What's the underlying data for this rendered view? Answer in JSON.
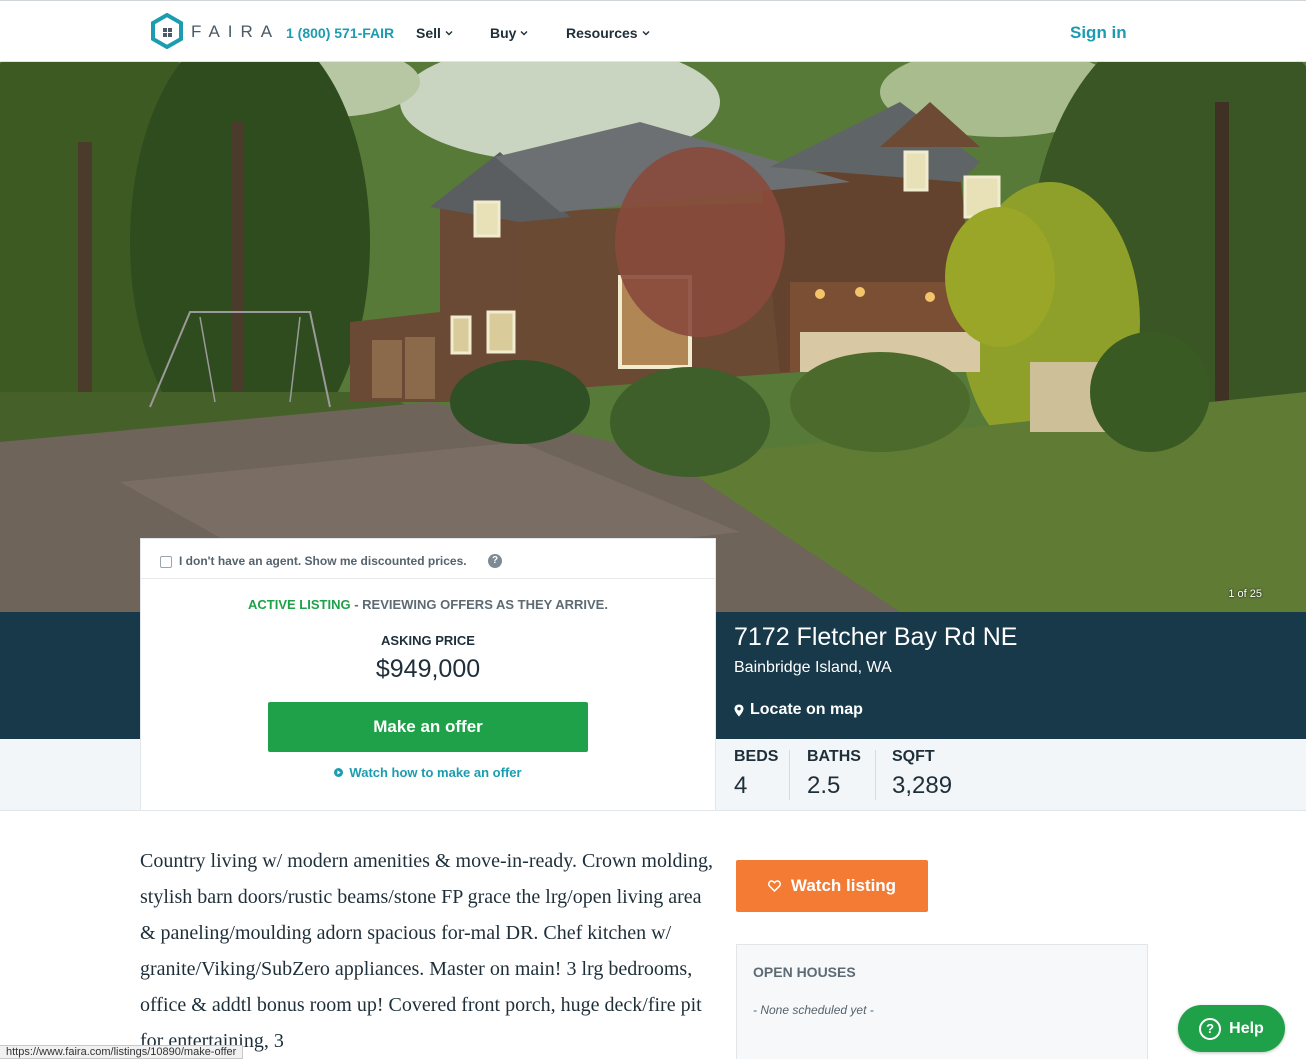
{
  "header": {
    "brand": "FAIRA",
    "phone": "1 (800) 571-FAIR",
    "nav": [
      "Sell",
      "Buy",
      "Resources"
    ],
    "sign_in": "Sign in"
  },
  "hero": {
    "photo_counter": "1 of 25"
  },
  "listing": {
    "address": "7172 Fletcher Bay Rd NE",
    "city": "Bainbridge Island, WA",
    "locate": "Locate on map",
    "stats": [
      {
        "label": "BEDS",
        "value": "4"
      },
      {
        "label": "BATHS",
        "value": "2.5"
      },
      {
        "label": "SQFT",
        "value": "3,289"
      }
    ]
  },
  "offer_card": {
    "no_agent_label": "I don't have an agent. Show me discounted prices.",
    "status_active": "ACTIVE LISTING",
    "status_rest": " - REVIEWING OFFERS AS THEY ARRIVE.",
    "asking_label": "ASKING PRICE",
    "price": "$949,000",
    "offer_button": "Make an offer",
    "watch_how": "Watch how to make an offer"
  },
  "description": "Country living w/ modern amenities & move-in-ready. Crown molding, stylish barn doors/rustic beams/stone FP grace the lrg/open living area & paneling/moulding adorn spacious for-mal DR. Chef kitchen w/ granite/Viking/SubZero appliances. Master on main! 3 lrg bedrooms, office & addtl bonus room up! Covered front porch, huge deck/fire pit for entertaining, 3",
  "sidebar": {
    "watch_listing": "Watch listing",
    "open_houses_title": "OPEN HOUSES",
    "open_houses_none": "- None scheduled yet -"
  },
  "help_button": "Help",
  "status_url": "https://www.faira.com/listings/10890/make-offer",
  "colors": {
    "teal": "#1c9cb0",
    "green": "#1fa14a",
    "orange": "#f47b34",
    "navy": "#17394a"
  }
}
